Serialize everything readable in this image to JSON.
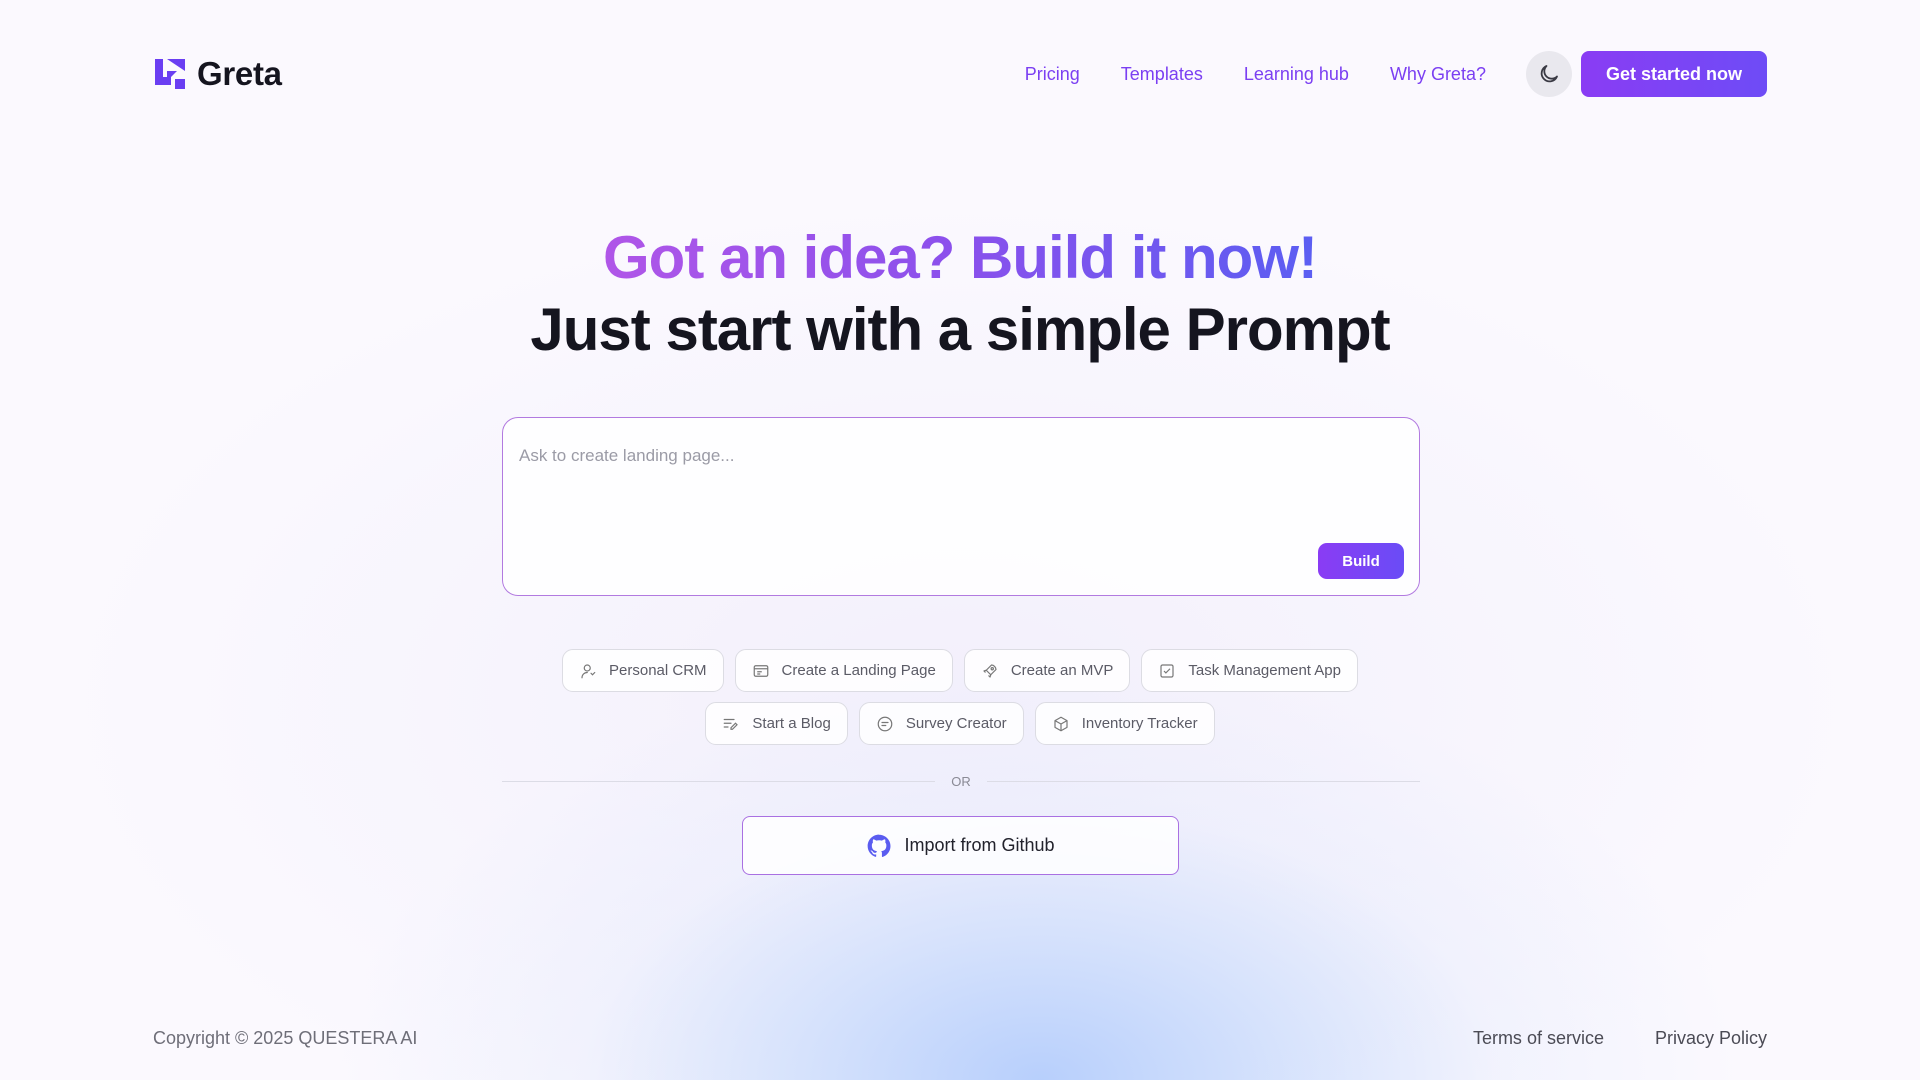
{
  "header": {
    "brand_name": "Greta",
    "nav": [
      {
        "label": "Pricing"
      },
      {
        "label": "Templates"
      },
      {
        "label": "Learning hub"
      },
      {
        "label": "Why Greta?"
      }
    ],
    "theme_icon": "moon-icon",
    "cta_label": "Get started now"
  },
  "hero": {
    "line1": "Got an idea? Build it now!",
    "line2": "Just start with a simple Prompt"
  },
  "prompt": {
    "placeholder": "Ask to create landing page...",
    "value": "",
    "build_label": "Build"
  },
  "chips": {
    "row1": [
      {
        "label": "Personal CRM",
        "icon": "user-icon"
      },
      {
        "label": "Create a Landing Page",
        "icon": "browser-window-icon"
      },
      {
        "label": "Create an MVP",
        "icon": "rocket-icon"
      },
      {
        "label": "Task Management App",
        "icon": "checklist-icon"
      }
    ],
    "row2": [
      {
        "label": "Start a Blog",
        "icon": "edit-lines-icon"
      },
      {
        "label": "Survey Creator",
        "icon": "survey-icon"
      },
      {
        "label": "Inventory Tracker",
        "icon": "box-icon"
      }
    ]
  },
  "divider": {
    "label": "OR"
  },
  "github": {
    "label": "Import from Github",
    "icon": "github-icon"
  },
  "footer": {
    "copyright": "Copyright © 2025 QUESTERA AI",
    "links": [
      {
        "label": "Terms of service"
      },
      {
        "label": "Privacy Policy"
      }
    ]
  },
  "colors": {
    "accent": "#7b3ff2",
    "gradient_start": "#8a3cf4",
    "gradient_end": "#6a4cf6"
  }
}
